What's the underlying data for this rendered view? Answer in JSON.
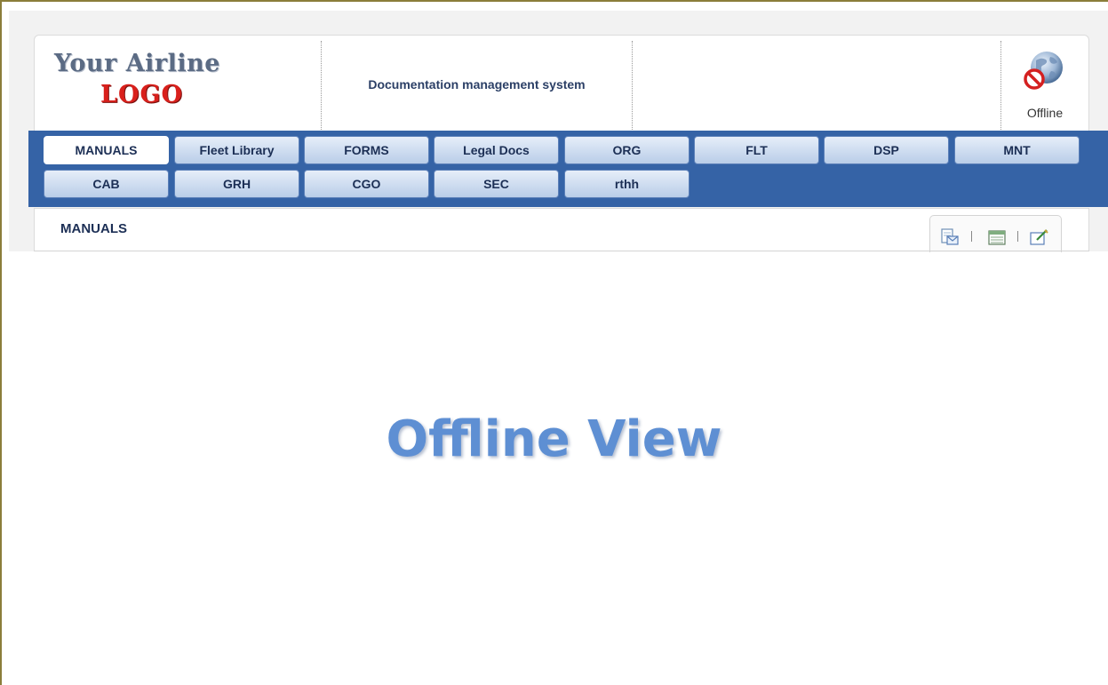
{
  "logo": {
    "line1": "Your Airline",
    "line2": "LOGO"
  },
  "header": {
    "title": "Documentation management system"
  },
  "status": {
    "label": "Offline",
    "icon": "offline-globe-icon"
  },
  "nav": {
    "row1": [
      "MANUALS",
      "Fleet Library",
      "FORMS",
      "Legal Docs",
      "ORG",
      "FLT",
      "DSP",
      "MNT"
    ],
    "row2": [
      "CAB",
      "GRH",
      "CGO",
      "SEC",
      "rthh"
    ],
    "active": "MANUALS"
  },
  "content": {
    "title": "MANUALS",
    "toolbar": [
      "email-document-icon",
      "calendar-icon",
      "edit-note-icon"
    ]
  },
  "banner": {
    "text": "Offline View"
  },
  "colors": {
    "nav_bar": "#3563a6",
    "banner": "#5e8fd3",
    "logo_red": "#d9201c"
  }
}
